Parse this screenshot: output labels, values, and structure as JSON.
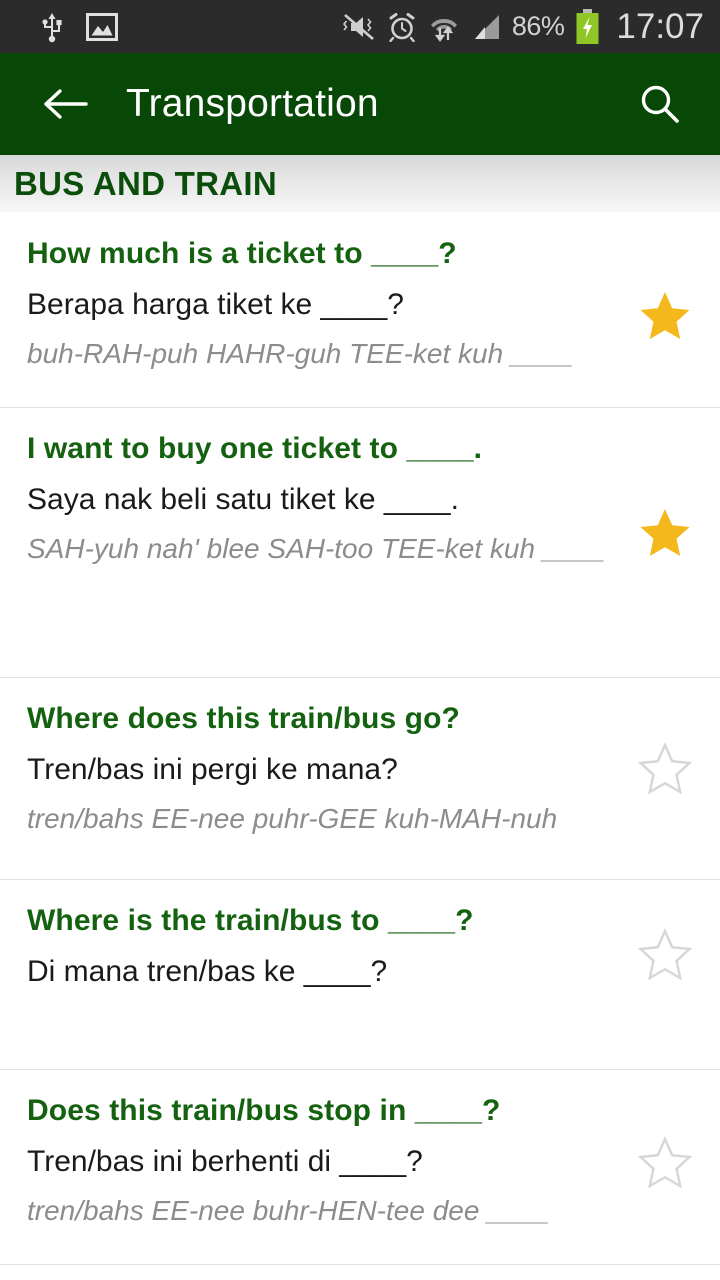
{
  "status_bar": {
    "icons_left": [
      "usb-icon",
      "screenshot-image-icon"
    ],
    "icons_right": [
      "mute-vibrate-icon",
      "alarm-clock-icon",
      "wifi-transfer-icon",
      "signal-bars-icon"
    ],
    "battery_percent": "86%",
    "battery_state": "charging",
    "clock": "17:07",
    "background_color": "#2b2b2b"
  },
  "app_bar": {
    "title": "Transportation",
    "back_icon": "back-arrow-icon",
    "search_icon": "search-icon",
    "background_color": "#084807"
  },
  "section": {
    "title": "BUS AND TRAIN",
    "color": "#0b4d0b"
  },
  "colors": {
    "english_green": "#14610f",
    "star_filled": "#f5b81c",
    "star_empty": "#d6d6d6",
    "pronunciation_gray": "#8c8c8c",
    "divider": "#e2e2e2"
  },
  "phrases": [
    {
      "en": "How much is a ticket to ____?",
      "ms": "Berapa harga tiket ke ____?",
      "pron": "buh-RAH-puh HAHR-guh TEE-ket kuh ____",
      "starred": true
    },
    {
      "en": "I want to buy one ticket to ____.",
      "ms": "Saya nak beli satu tiket ke ____.",
      "pron": "SAH-yuh nah' blee SAH-too TEE-ket kuh ____",
      "starred": true
    },
    {
      "en": "Where does this train/bus go?",
      "ms": "Tren/bas ini pergi ke mana?",
      "pron": "tren/bahs EE-nee puhr-GEE kuh-MAH-nuh",
      "starred": false
    },
    {
      "en": "Where is the train/bus to ____?",
      "ms": "Di mana tren/bas ke ____?",
      "pron": "",
      "starred": false
    },
    {
      "en": "Does this train/bus stop in ____?",
      "ms": "Tren/bas ini berhenti di ____?",
      "pron": "tren/bahs EE-nee buhr-HEN-tee dee ____",
      "starred": false
    }
  ]
}
